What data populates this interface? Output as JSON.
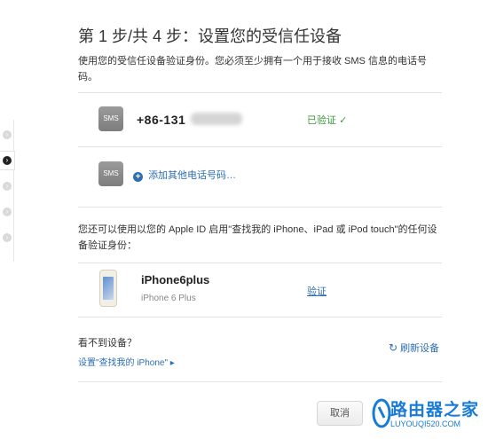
{
  "header": {
    "title": "第 1 步/共 4 步：设置您的受信任设备",
    "description": "使用您的受信任设备验证身份。您必须至少拥有一个用于接收 SMS 信息的电话号码。"
  },
  "phones": {
    "sms_icon_label": "SMS",
    "number": "+86-131",
    "verified_label": "已验证",
    "verified_mark": "✓",
    "add_label": "添加其他电话号码…",
    "add_icon": "+"
  },
  "find_iphone": {
    "description": "您还可以使用以您的 Apple ID 启用\"查找我的 iPhone、iPad 或 iPod touch\"的任何设备验证身份："
  },
  "device": {
    "name": "iPhone6plus",
    "model": "iPhone 6 Plus",
    "verify_label": "验证"
  },
  "footer": {
    "cant_see": "看不到设备？",
    "setup_link": "设置\"查找我的 iPhone\"",
    "setup_arrow": "▸",
    "refresh_label": "刷新设备",
    "refresh_icon": "↻",
    "cancel_label": "取消"
  },
  "steps": {
    "arrow": "›"
  },
  "watermark": {
    "text": "路由器之家",
    "url": "LUYOUQI520.COM"
  },
  "colors": {
    "link": "#2d6fb3",
    "verified": "#3c9a3c"
  }
}
